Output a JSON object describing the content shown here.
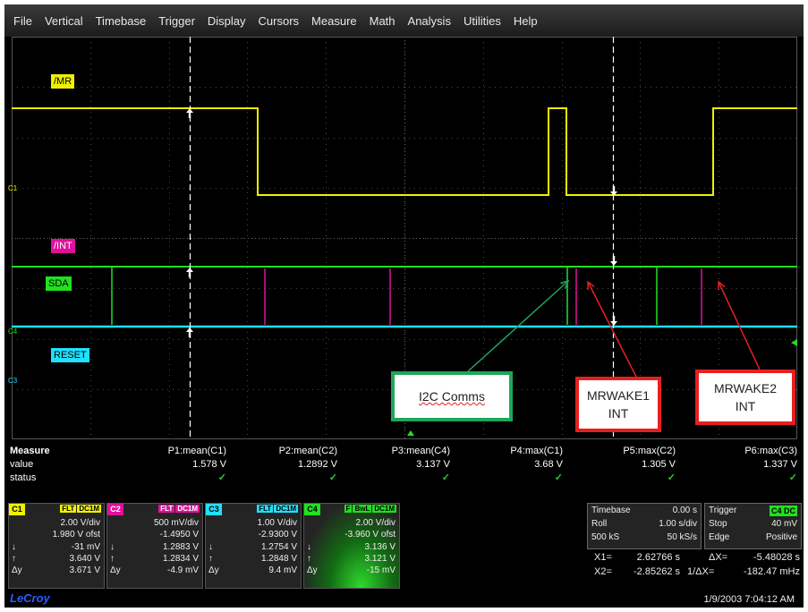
{
  "menu": [
    "File",
    "Vertical",
    "Timebase",
    "Trigger",
    "Display",
    "Cursors",
    "Measure",
    "Math",
    "Analysis",
    "Utilities",
    "Help"
  ],
  "traces": {
    "mr_label": "/MR",
    "int_label": "/INT",
    "sda_label": "SDA",
    "reset_label": "RESET",
    "c1_marker": "C1",
    "c4_marker": "C4",
    "c3_marker": "C3"
  },
  "callouts": {
    "i2c": "I2C Comms",
    "mrwake1_line1": "MRWAKE1",
    "mrwake1_line2": "INT",
    "mrwake2_line1": "MRWAKE2",
    "mrwake2_line2": "INT"
  },
  "colors": {
    "c1": "#f0f000",
    "c2": "#e0109c",
    "c3": "#20e0ff",
    "c4": "#20e020",
    "callout_green": "#1fa65a",
    "callout_red": "#e62020"
  },
  "measure": {
    "title": "Measure",
    "row_value": "value",
    "row_status": "status",
    "params": [
      {
        "name": "P1:mean(C1)",
        "value": "1.578 V"
      },
      {
        "name": "P2:mean(C2)",
        "value": "1.2892 V"
      },
      {
        "name": "P3:mean(C4)",
        "value": "3.137 V"
      },
      {
        "name": "P4:max(C1)",
        "value": "3.68 V"
      },
      {
        "name": "P5:max(C2)",
        "value": "1.305 V"
      },
      {
        "name": "P6:max(C3)",
        "value": "1.337 V"
      }
    ],
    "status_mark": "✓"
  },
  "channels": [
    {
      "tag": "C1",
      "flags": [
        "FLT",
        "DC1M"
      ],
      "vdiv": "2.00 V/div",
      "ofst": "1.980 V ofst",
      "down": "-31 mV",
      "up": "3.640 V",
      "dy": "3.671 V"
    },
    {
      "tag": "C2",
      "flags": [
        "FLT",
        "DC1M"
      ],
      "vdiv": "500 mV/div",
      "ofst": "-1.4950 V",
      "down": "1.2883 V",
      "up": "1.2834 V",
      "dy": "-4.9 mV"
    },
    {
      "tag": "C3",
      "flags": [
        "FLT",
        "DC1M"
      ],
      "vdiv": "1.00 V/div",
      "ofst": "-2.9300 V",
      "down": "1.2754 V",
      "up": "1.2848 V",
      "dy": "9.4 mV"
    },
    {
      "tag": "C4",
      "flags": [
        "F",
        "BwL",
        "DC1M"
      ],
      "vdiv": "2.00 V/div",
      "ofst": "-3.960 V ofst",
      "down": "3.136 V",
      "up": "3.121 V",
      "dy": "-15 mV"
    }
  ],
  "sym": {
    "down": "↓",
    "up": "↑",
    "dy": "Δy"
  },
  "timebase": {
    "label": "Timebase",
    "delay": "0.00 s",
    "mode": "Roll",
    "tdiv": "1.00 s/div",
    "samples": "500 kS",
    "rate": "50 kS/s"
  },
  "trigger": {
    "label": "Trigger",
    "src": "C4 DC",
    "mode": "Stop",
    "level": "40 mV",
    "type": "Edge",
    "slope": "Positive"
  },
  "cursors": {
    "x1_label": "X1=",
    "x1": "2.62766 s",
    "dx_label": "ΔX=",
    "dx": "-5.48028 s",
    "x2_label": "X2=",
    "x2": "-2.85262 s",
    "idx_label": "1/ΔX=",
    "idx": "-182.47 mHz"
  },
  "brand": "LeCroy",
  "datetime": "1/9/2003 7:04:12 AM"
}
